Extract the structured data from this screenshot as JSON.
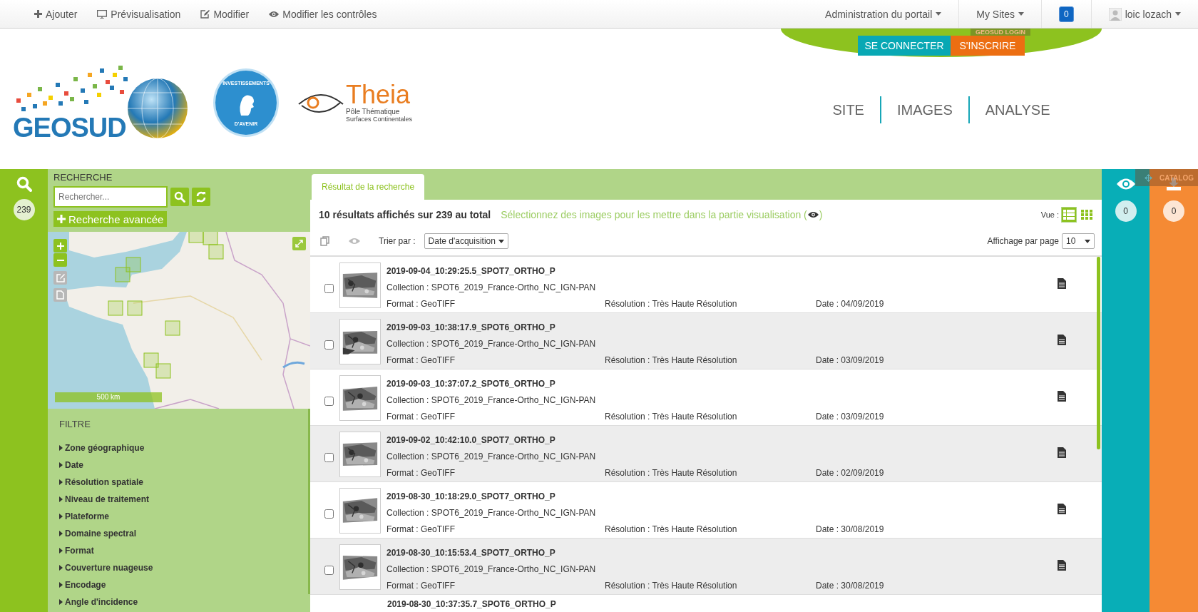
{
  "top_bar": {
    "left_items": [
      {
        "label": "Ajouter"
      },
      {
        "label": "Prévisualisation"
      },
      {
        "label": "Modifier"
      },
      {
        "label": "Modifier les contrôles"
      }
    ],
    "admin_menu": "Administration du portail",
    "sites_menu": "My Sites",
    "notifications": "0",
    "user": "loic lozach"
  },
  "header": {
    "geosud_logo": "GEOSUD",
    "investissements_logo": [
      "INVESTISSEMENTS",
      "D'AVENIR"
    ],
    "theia_logo": {
      "name": "Theia",
      "line_1": "Pôle Thématique",
      "line_2": "Surfaces Continentales"
    },
    "auth_buttons": [
      "SE CONNECTER",
      "S'INSCRIRE"
    ],
    "login_tag": "GEOSUD LOGIN",
    "nav": [
      "SITE",
      "IMAGES",
      "ANALYSE"
    ]
  },
  "search_rail": {
    "count": "239"
  },
  "search_panel": {
    "title": "RECHERCHE",
    "search": {
      "placeholder": "Rechercher..."
    },
    "advanced_button": "Recherche avancée",
    "map": {
      "kind": "picture",
      "scale": "500 km"
    },
    "filter": {
      "title": "FILTRE",
      "items": [
        {
          "label": "Zone géographique",
          "expanded": false
        },
        {
          "label": "Date",
          "expanded": false
        },
        {
          "label": "Résolution spatiale",
          "expanded": false
        },
        {
          "label": "Niveau de traitement",
          "expanded": false
        },
        {
          "label": "Plateforme",
          "expanded": false
        },
        {
          "label": "Domaine spectral",
          "expanded": false
        },
        {
          "label": "Format",
          "expanded": false
        },
        {
          "label": "Couverture nuageuse",
          "expanded": false
        },
        {
          "label": "Encodage",
          "expanded": false
        },
        {
          "label": "Angle d'incidence",
          "expanded": false
        }
      ]
    }
  },
  "results": {
    "tab": {
      "label": "Résultat de la recherche",
      "selected": true
    },
    "summary": "10 résultats affichés sur 239 au total",
    "hint": "Sélectionnez des images pour les mettre dans la partie visualisation (",
    "hint_end": ")",
    "view_label": "Vue :",
    "views": [
      {
        "selected": true
      },
      {
        "selected": false
      }
    ],
    "sort_label": "Trier par :",
    "sort_value": "Date d'acquisition",
    "per_page_label": "Affichage par page",
    "per_page_value": "10",
    "rows": [
      {
        "title": "2019-09-04_10:29:25.5_SPOT7_ORTHO_P",
        "collection": "Collection : SPOT6_2019_France-Ortho_NC_IGN-PAN",
        "format": "Format : GeoTIFF",
        "resolution": "Résolution : Très Haute Résolution",
        "date": "Date : 04/09/2019",
        "checked": false
      },
      {
        "title": "2019-09-03_10:38:17.9_SPOT6_ORTHO_P",
        "collection": "Collection : SPOT6_2019_France-Ortho_NC_IGN-PAN",
        "format": "Format : GeoTIFF",
        "resolution": "Résolution : Très Haute Résolution",
        "date": "Date : 03/09/2019",
        "checked": false
      },
      {
        "title": "2019-09-03_10:37:07.2_SPOT6_ORTHO_P",
        "collection": "Collection : SPOT6_2019_France-Ortho_NC_IGN-PAN",
        "format": "Format : GeoTIFF",
        "resolution": "Résolution : Très Haute Résolution",
        "date": "Date : 03/09/2019",
        "checked": false
      },
      {
        "title": "2019-09-02_10:42:10.0_SPOT7_ORTHO_P",
        "collection": "Collection : SPOT6_2019_France-Ortho_NC_IGN-PAN",
        "format": "Format : GeoTIFF",
        "resolution": "Résolution : Très Haute Résolution",
        "date": "Date : 02/09/2019",
        "checked": false
      },
      {
        "title": "2019-08-30_10:18:29.0_SPOT7_ORTHO_P",
        "collection": "Collection : SPOT6_2019_France-Ortho_NC_IGN-PAN",
        "format": "Format : GeoTIFF",
        "resolution": "Résolution : Très Haute Résolution",
        "date": "Date : 30/08/2019",
        "checked": false
      },
      {
        "title": "2019-08-30_10:15:53.4_SPOT7_ORTHO_P",
        "collection": "Collection : SPOT6_2019_France-Ortho_NC_IGN-PAN",
        "format": "Format : GeoTIFF",
        "resolution": "Résolution : Très Haute Résolution",
        "date": "Date : 30/08/2019",
        "checked": false
      },
      {
        "title": "2019-08-30_10:37:35.7_SPOT6_ORTHO_P"
      }
    ]
  },
  "visualisation": {
    "count": "0"
  },
  "cart": {
    "count": "0"
  },
  "catalog_tag": "CATALOG"
}
